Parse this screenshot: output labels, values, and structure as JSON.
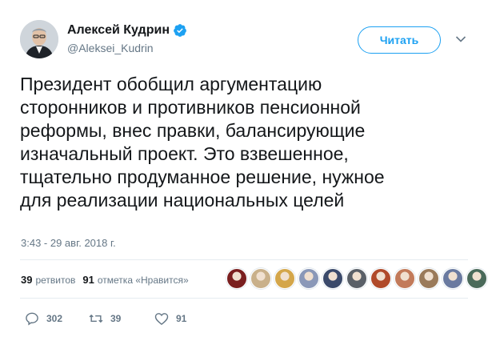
{
  "tweet": {
    "display_name": "Алексей Кудрин",
    "handle": "@Aleksei_Kudrin",
    "follow_label": "Читать",
    "text": "Президент обобщил аргументацию\nсторонников и противников пенсионной\nреформы, внес правки, балансирующие\nизначальный проект. Это взвешенное,\nтщательно продуманное решение, нужное\nдля реализации национальных целей",
    "timestamp": "3:43 - 29 авг. 2018 г."
  },
  "stats": {
    "retweets_count": "39",
    "retweets_label": "ретвитов",
    "likes_count": "91",
    "likes_label": "отметка «Нравится»"
  },
  "actions": {
    "replies": "302",
    "retweets": "39",
    "likes": "91"
  },
  "colors": {
    "accent": "#1da1f2",
    "muted": "#657786",
    "text": "#14171a"
  },
  "likers": [
    {
      "color": "#7a1f1f"
    },
    {
      "color": "#c9b08a"
    },
    {
      "color": "#d4a64a"
    },
    {
      "color": "#8a98b8"
    },
    {
      "color": "#3b4a6b"
    },
    {
      "color": "#5a6068"
    },
    {
      "color": "#b04a2a"
    },
    {
      "color": "#c27a5a"
    },
    {
      "color": "#9a7a5a"
    },
    {
      "color": "#6a7aa0"
    },
    {
      "color": "#4a6a5a"
    },
    {
      "color": "#8a8a8a"
    }
  ]
}
